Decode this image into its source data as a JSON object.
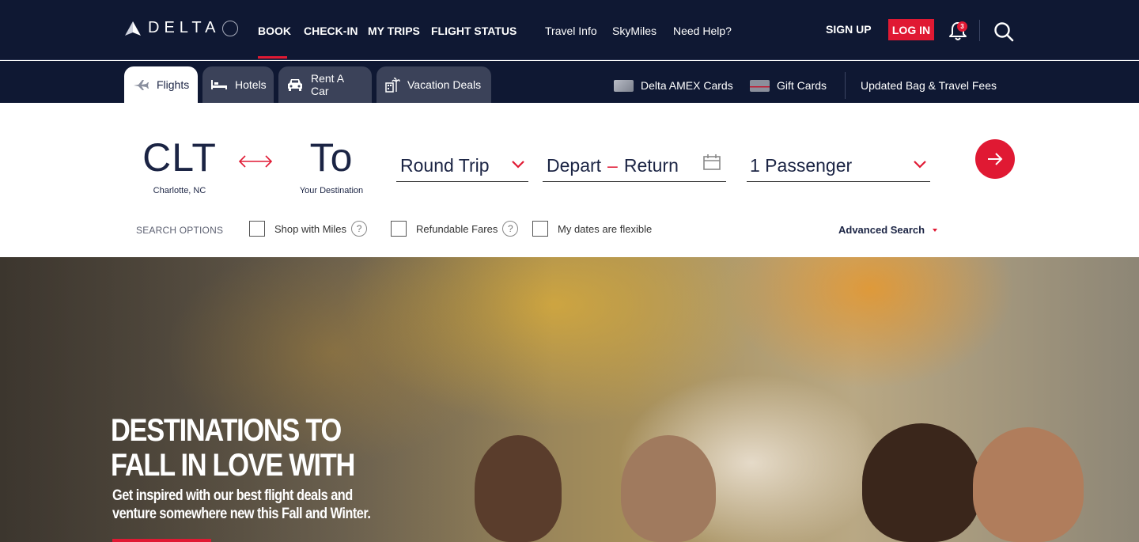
{
  "header": {
    "brand": "DELTA",
    "main_nav": [
      "BOOK",
      "CHECK-IN",
      "MY TRIPS",
      "FLIGHT STATUS"
    ],
    "secondary_nav": [
      "Travel Info",
      "SkyMiles",
      "Need Help?"
    ],
    "sign_up": "SIGN UP",
    "log_in": "LOG IN",
    "notification_count": "3",
    "colors": {
      "navy": "#0f1833",
      "red": "#e01933"
    }
  },
  "subnav": {
    "tabs": [
      "Flights",
      "Hotels",
      "Rent A Car",
      "Vacation Deals"
    ],
    "links": [
      "Delta AMEX Cards",
      "Gift Cards",
      "Updated Bag & Travel Fees"
    ]
  },
  "booking": {
    "origin_code": "CLT",
    "origin_city": "Charlotte, NC",
    "destination_code": "To",
    "destination_label": "Your Destination",
    "trip_type": "Round Trip",
    "depart": "Depart",
    "return": "Return",
    "passengers": "1 Passenger",
    "search_options_label": "SEARCH OPTIONS",
    "options": [
      "Shop with Miles",
      "Refundable Fares",
      "My dates are flexible"
    ],
    "advanced_search": "Advanced Search"
  },
  "hero": {
    "title_line1": "DESTINATIONS TO",
    "title_line2": "FALL IN LOVE WITH",
    "subtitle_line1": "Get inspired with our best flight deals and",
    "subtitle_line2": "venture somewhere new this Fall and Winter."
  }
}
